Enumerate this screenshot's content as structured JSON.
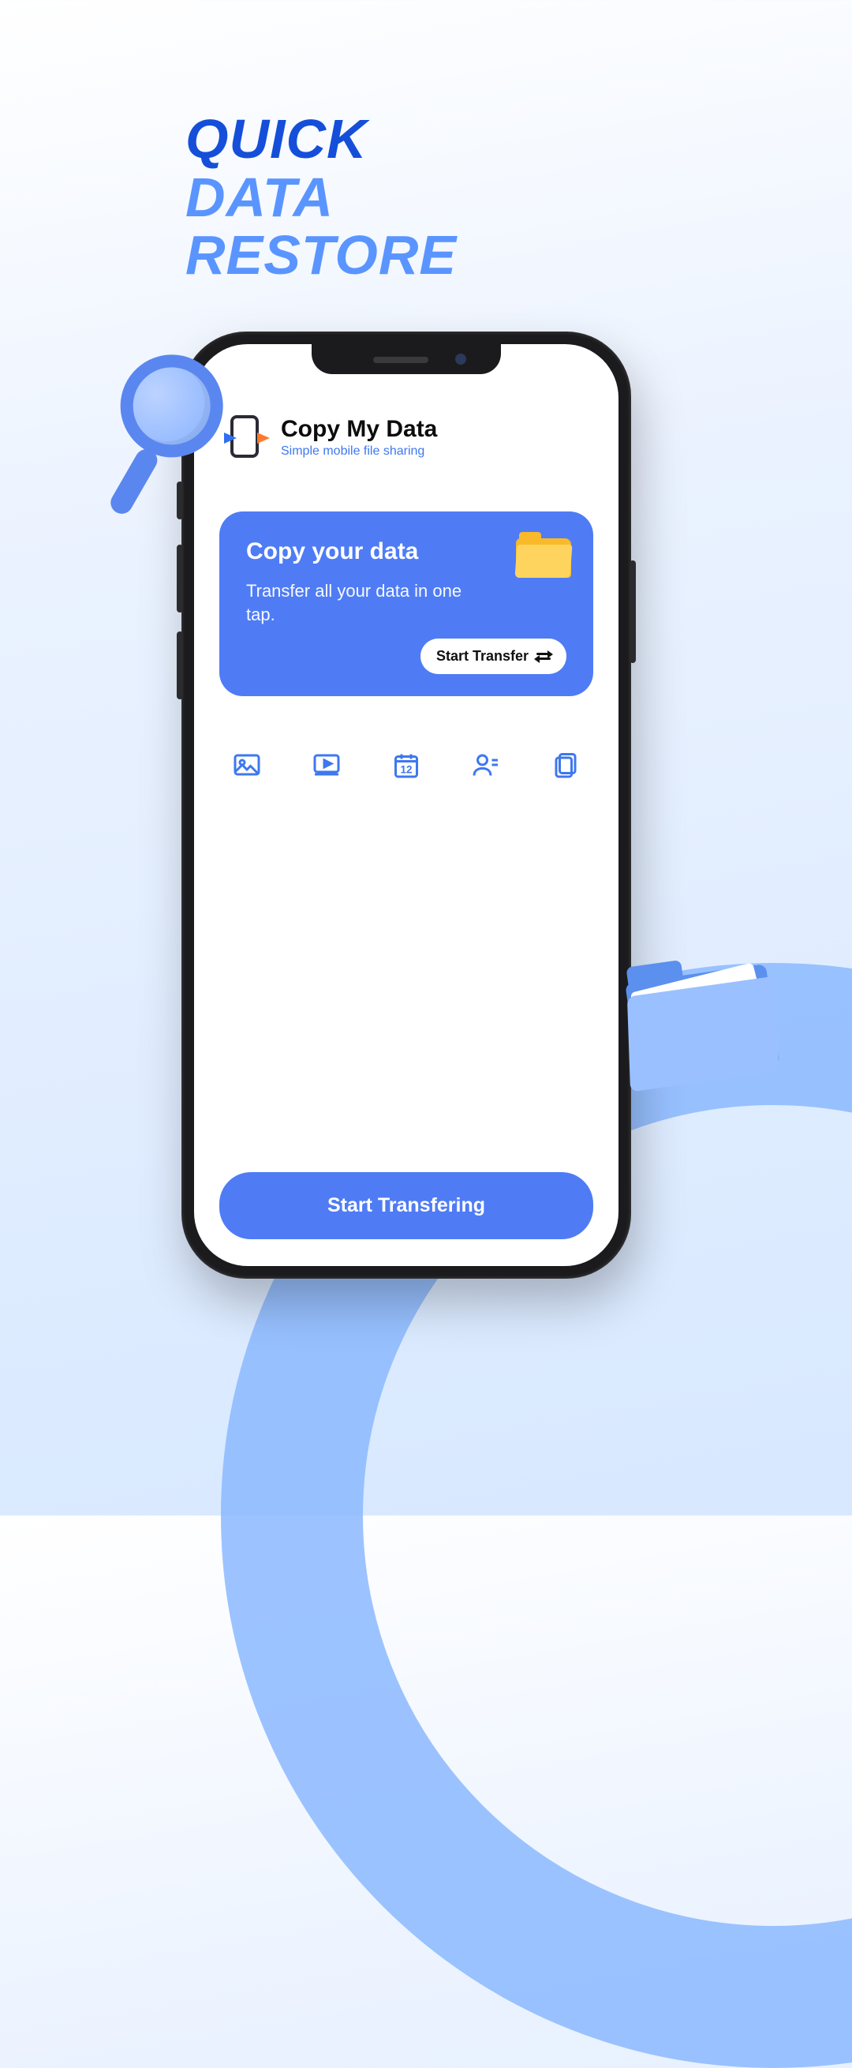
{
  "headline": {
    "line1": "QUICK",
    "line2": "DATA",
    "line3": "RESTORE"
  },
  "app": {
    "title": "Copy My Data",
    "subtitle": "Simple mobile file sharing"
  },
  "card": {
    "title": "Copy your data",
    "description": "Transfer all your data in one tap.",
    "button_label": "Start Transfer"
  },
  "types": {
    "photos": "Photos",
    "videos": "Videos",
    "calendar": "Calendar",
    "contacts": "Contacts",
    "documents": "Documents",
    "calendar_day": "12"
  },
  "cta": {
    "label": "Start Transfering"
  },
  "colors": {
    "primary": "#4f7cf5",
    "accent_dark": "#154fd9",
    "accent_light": "#5a95ff"
  }
}
